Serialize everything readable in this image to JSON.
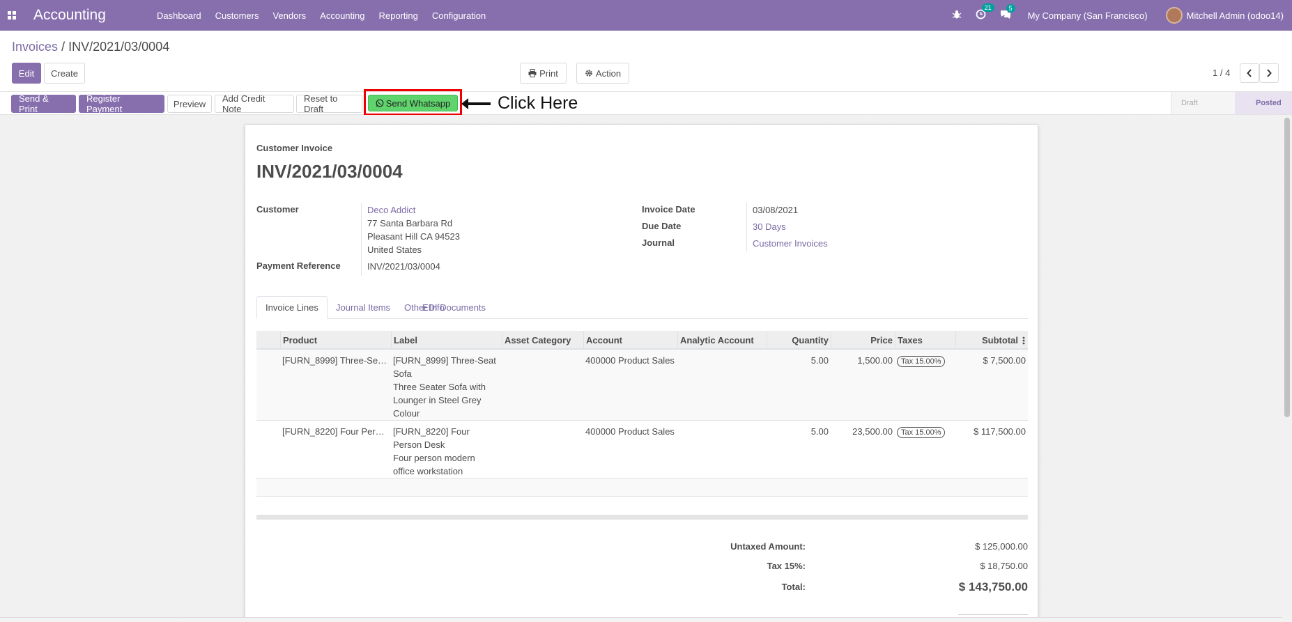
{
  "navbar": {
    "app_name": "Accounting",
    "menu": [
      "Dashboard",
      "Customers",
      "Vendors",
      "Accounting",
      "Reporting",
      "Configuration"
    ],
    "activity_count": "21",
    "message_count": "5",
    "company": "My Company (San Francisco)",
    "user": "Mitchell Admin (odoo14)",
    "accent_color": "#876fae"
  },
  "breadcrumb": {
    "parent": "Invoices",
    "separator": "/",
    "current": "INV/2021/03/0004"
  },
  "control": {
    "edit_label": "Edit",
    "create_label": "Create",
    "print_label": "Print",
    "action_label": "Action",
    "pager": "1 / 4"
  },
  "statusbar": {
    "buttons": [
      "Send & Print",
      "Register Payment",
      "Preview",
      "Add Credit Note",
      "Reset to Draft"
    ],
    "whatsapp_label": "Send Whatsapp",
    "annotation": "Click Here",
    "stages": [
      "Draft",
      "Posted"
    ],
    "whatsapp_color": "#5fd36c",
    "highlight_color": "#ee0000"
  },
  "invoice": {
    "subtitle": "Customer Invoice",
    "number": "INV/2021/03/0004",
    "customer_label": "Customer",
    "customer_name": "Deco Addict",
    "address": [
      "77 Santa Barbara Rd",
      "Pleasant Hill CA 94523",
      "United States"
    ],
    "payment_ref_label": "Payment Reference",
    "payment_ref": "INV/2021/03/0004",
    "invoice_date_label": "Invoice Date",
    "invoice_date": "03/08/2021",
    "due_date_label": "Due Date",
    "due_date": "30 Days",
    "journal_label": "Journal",
    "journal": "Customer Invoices"
  },
  "tabs": [
    "Invoice Lines",
    "Journal Items",
    "Other Info",
    "EDI Documents"
  ],
  "lines": {
    "headers": [
      "Product",
      "Label",
      "Asset Category",
      "Account",
      "Analytic Account",
      "Quantity",
      "Price",
      "Taxes",
      "Subtotal"
    ],
    "rows": [
      {
        "product": "[FURN_8999] Three-Se…",
        "label": [
          "[FURN_8999] Three-Seat",
          "Sofa",
          "Three Seater Sofa with",
          "Lounger in Steel Grey",
          "Colour"
        ],
        "account": "400000 Product Sales",
        "quantity": "5.00",
        "price": "1,500.00",
        "tax": "Tax 15.00%",
        "subtotal": "$ 7,500.00"
      },
      {
        "product": "[FURN_8220] Four Per…",
        "label": [
          "[FURN_8220] Four",
          "Person Desk",
          "Four person modern",
          "office workstation"
        ],
        "account": "400000 Product Sales",
        "quantity": "5.00",
        "price": "23,500.00",
        "tax": "Tax 15.00%",
        "subtotal": "$ 117,500.00"
      }
    ]
  },
  "totals": {
    "untaxed_label": "Untaxed Amount:",
    "untaxed": "$ 125,000.00",
    "tax_label": "Tax 15%:",
    "tax": "$ 18,750.00",
    "total_label": "Total:",
    "total": "$ 143,750.00"
  }
}
